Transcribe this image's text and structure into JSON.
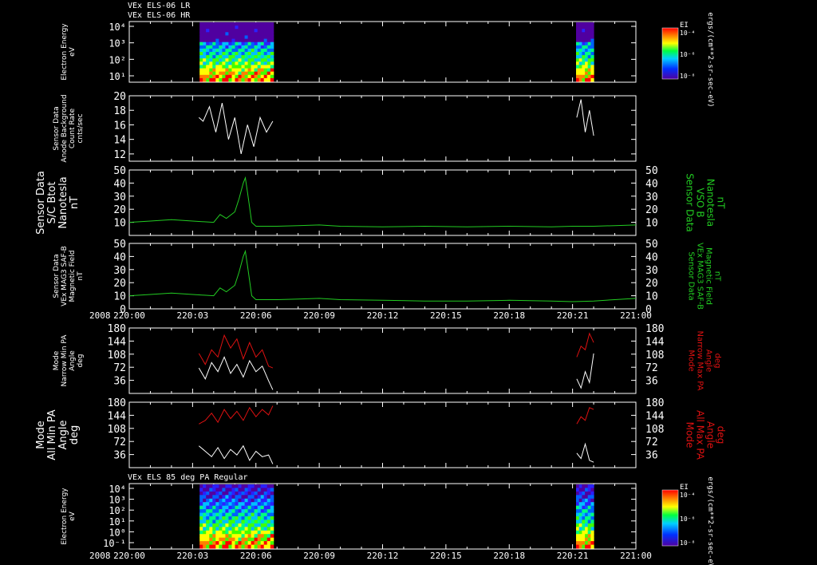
{
  "header": {
    "line1": "VEx ELS-06 LR",
    "line2": "VEx ELS-06 HR",
    "mid_title": "VEx ELS 85 deg PA Regular"
  },
  "colors": {
    "background": "#000000",
    "axis": "#ffffff",
    "white_trace": "#ffffff",
    "green_trace": "#22cc22",
    "red_trace": "#dd1111"
  },
  "time_axis": {
    "year_label": "2008",
    "ticks": [
      "220:00",
      "220:03",
      "220:06",
      "220:09",
      "220:12",
      "220:15",
      "220:18",
      "220:21",
      "221:00"
    ]
  },
  "chart_data": [
    {
      "type": "heatmap",
      "id": "p1",
      "ylabel_lines": [
        "Electron Energy",
        "eV"
      ],
      "yscale": "log",
      "ytick_labels": [
        "10⁴",
        "10³",
        "10²",
        "10¹"
      ],
      "colorbar": {
        "title": "EI",
        "tick_labels": [
          "10⁻⁴",
          "10⁻⁶",
          "10⁻⁸"
        ],
        "units": "ergs/(cm**2-sr-sec-eV)"
      },
      "data_intervals": [
        [
          "220:03:20",
          "220:06:50"
        ],
        [
          "220:21:10",
          "220:22:00"
        ]
      ]
    },
    {
      "type": "line",
      "id": "p2",
      "ylabel_lines": [
        "Sensor Data",
        "Anode Background",
        "Count Rate",
        "cnts/sec"
      ],
      "ylim": [
        11,
        20
      ],
      "ytick_labels": [
        "20",
        "18",
        "16",
        "14",
        "12"
      ],
      "ytick_values": [
        20,
        18,
        16,
        14,
        12
      ],
      "series": [
        {
          "color": "white",
          "segments": [
            {
              "t": [
                3.3,
                3.5,
                3.8,
                4.1,
                4.4,
                4.7,
                5.0,
                5.3,
                5.6,
                5.9,
                6.2,
                6.5,
                6.8
              ],
              "y": [
                17,
                16.5,
                18.5,
                15,
                19,
                14,
                17,
                12,
                16,
                13,
                17,
                15,
                16.5
              ]
            },
            {
              "t": [
                21.2,
                21.4,
                21.6,
                21.8,
                22.0
              ],
              "y": [
                17,
                19.5,
                15,
                18,
                14.5
              ]
            }
          ]
        }
      ]
    },
    {
      "type": "line",
      "id": "p3",
      "ylabel_lines": [
        "Sensor Data",
        "S/C Btot",
        "Nanotesla",
        "nT"
      ],
      "rlabel_lines": [
        "Sensor Data",
        "VSO B",
        "Nanotesla",
        "nT"
      ],
      "ylim": [
        0,
        50
      ],
      "ytick_labels": [
        "50",
        "40",
        "30",
        "20",
        "10"
      ],
      "ytick_values": [
        50,
        40,
        30,
        20,
        10
      ],
      "series": [
        {
          "color": "green",
          "segments": [
            {
              "t": [
                0,
                1,
                2,
                3,
                4,
                4.3,
                4.6,
                5.0,
                5.2,
                5.4,
                5.5,
                5.6,
                5.8,
                6.0,
                7,
                8,
                9,
                10,
                12,
                14,
                16,
                18,
                20,
                21,
                22,
                23,
                24
              ],
              "y": [
                10,
                11,
                12,
                11,
                10,
                16,
                13,
                18,
                28,
                40,
                44,
                33,
                10,
                7,
                7,
                7.5,
                8,
                7,
                6.5,
                7,
                6.5,
                7,
                6.5,
                7,
                7,
                7.5,
                8
              ]
            }
          ]
        }
      ]
    },
    {
      "type": "line",
      "id": "p4",
      "ylabel_lines": [
        "Sensor Data",
        "VEx MAG3 SAF-B",
        "Magnetic Field",
        "nT"
      ],
      "rlabel_lines": [
        "Sensor Data",
        "VEx MAG3 SAF-B",
        "Magnetic Field",
        "nT"
      ],
      "ylim": [
        0,
        50
      ],
      "ytick_labels": [
        "50",
        "40",
        "30",
        "20",
        "10",
        "0"
      ],
      "ytick_values": [
        50,
        40,
        30,
        20,
        10,
        0
      ],
      "series": [
        {
          "color": "green",
          "segments": [
            {
              "t": [
                0,
                1,
                2,
                3,
                4,
                4.3,
                4.6,
                5.0,
                5.2,
                5.4,
                5.5,
                5.6,
                5.8,
                6.0,
                7,
                8,
                9,
                10,
                12,
                14,
                16,
                18,
                20,
                21,
                22,
                23,
                24
              ],
              "y": [
                10,
                11,
                12,
                11,
                10,
                16,
                13,
                18,
                28,
                40,
                44,
                33,
                10,
                7,
                7,
                7.5,
                8,
                7,
                6.5,
                6,
                6,
                6.5,
                6,
                5.5,
                6,
                7,
                8
              ]
            }
          ]
        }
      ]
    },
    {
      "type": "line",
      "id": "p5",
      "ylabel_lines": [
        "Mode",
        "Narrow Min PA",
        "Angle",
        "deg"
      ],
      "rlabel_lines": [
        "Mode",
        "Narrow Max PA",
        "Angle",
        "deg"
      ],
      "ylim": [
        0,
        180
      ],
      "ytick_labels": [
        "180",
        "144",
        "108",
        "72",
        "36"
      ],
      "ytick_values": [
        180,
        144,
        108,
        72,
        36
      ],
      "series": [
        {
          "color": "red",
          "segments": [
            {
              "t": [
                3.3,
                3.6,
                3.9,
                4.2,
                4.5,
                4.8,
                5.1,
                5.4,
                5.7,
                6.0,
                6.3,
                6.6,
                6.8
              ],
              "y": [
                110,
                80,
                120,
                100,
                160,
                125,
                150,
                95,
                140,
                100,
                120,
                75,
                70
              ]
            },
            {
              "t": [
                21.2,
                21.4,
                21.6,
                21.8,
                22.0
              ],
              "y": [
                100,
                130,
                120,
                165,
                140
              ]
            }
          ]
        },
        {
          "color": "white",
          "segments": [
            {
              "t": [
                3.3,
                3.6,
                3.9,
                4.2,
                4.5,
                4.8,
                5.1,
                5.4,
                5.7,
                6.0,
                6.3,
                6.6,
                6.8
              ],
              "y": [
                70,
                40,
                85,
                60,
                100,
                55,
                80,
                45,
                90,
                60,
                75,
                35,
                10
              ]
            },
            {
              "t": [
                21.2,
                21.4,
                21.6,
                21.8,
                22.0
              ],
              "y": [
                40,
                15,
                60,
                30,
                110
              ]
            }
          ]
        }
      ]
    },
    {
      "type": "line",
      "id": "p6",
      "ylabel_lines": [
        "Mode",
        "All Min PA",
        "Angle",
        "deg"
      ],
      "rlabel_lines": [
        "Mode",
        "All Max PA",
        "Angle",
        "deg"
      ],
      "ylim": [
        0,
        180
      ],
      "ytick_labels": [
        "180",
        "144",
        "108",
        "72",
        "36"
      ],
      "ytick_values": [
        180,
        144,
        108,
        72,
        36
      ],
      "series": [
        {
          "color": "red",
          "segments": [
            {
              "t": [
                3.3,
                3.6,
                3.9,
                4.2,
                4.5,
                4.8,
                5.1,
                5.4,
                5.7,
                6.0,
                6.3,
                6.6,
                6.8
              ],
              "y": [
                120,
                130,
                150,
                125,
                160,
                135,
                155,
                130,
                165,
                140,
                160,
                145,
                170
              ]
            },
            {
              "t": [
                21.2,
                21.4,
                21.6,
                21.8,
                22.0
              ],
              "y": [
                120,
                140,
                130,
                165,
                160
              ]
            }
          ]
        },
        {
          "color": "white",
          "segments": [
            {
              "t": [
                3.3,
                3.6,
                3.9,
                4.2,
                4.5,
                4.8,
                5.1,
                5.4,
                5.7,
                6.0,
                6.3,
                6.6,
                6.8
              ],
              "y": [
                60,
                45,
                30,
                55,
                25,
                50,
                35,
                60,
                20,
                45,
                30,
                35,
                10
              ]
            },
            {
              "t": [
                21.2,
                21.4,
                21.6,
                21.8,
                22.0
              ],
              "y": [
                40,
                25,
                65,
                20,
                15
              ]
            }
          ]
        }
      ]
    },
    {
      "type": "heatmap",
      "id": "p7",
      "ylabel_lines": [
        "Electron Energy",
        "eV"
      ],
      "yscale": "log",
      "ytick_labels": [
        "10⁴",
        "10³",
        "10²",
        "10¹",
        "10⁰",
        "10⁻¹"
      ],
      "colorbar": {
        "title": "EI",
        "tick_labels": [
          "10⁻⁴",
          "10⁻⁶",
          "10⁻⁸"
        ],
        "units": "ergs/(cm**2-sr-sec-eV)"
      },
      "data_intervals": [
        [
          "220:03:20",
          "220:06:50"
        ],
        [
          "220:21:10",
          "220:22:00"
        ]
      ]
    }
  ]
}
